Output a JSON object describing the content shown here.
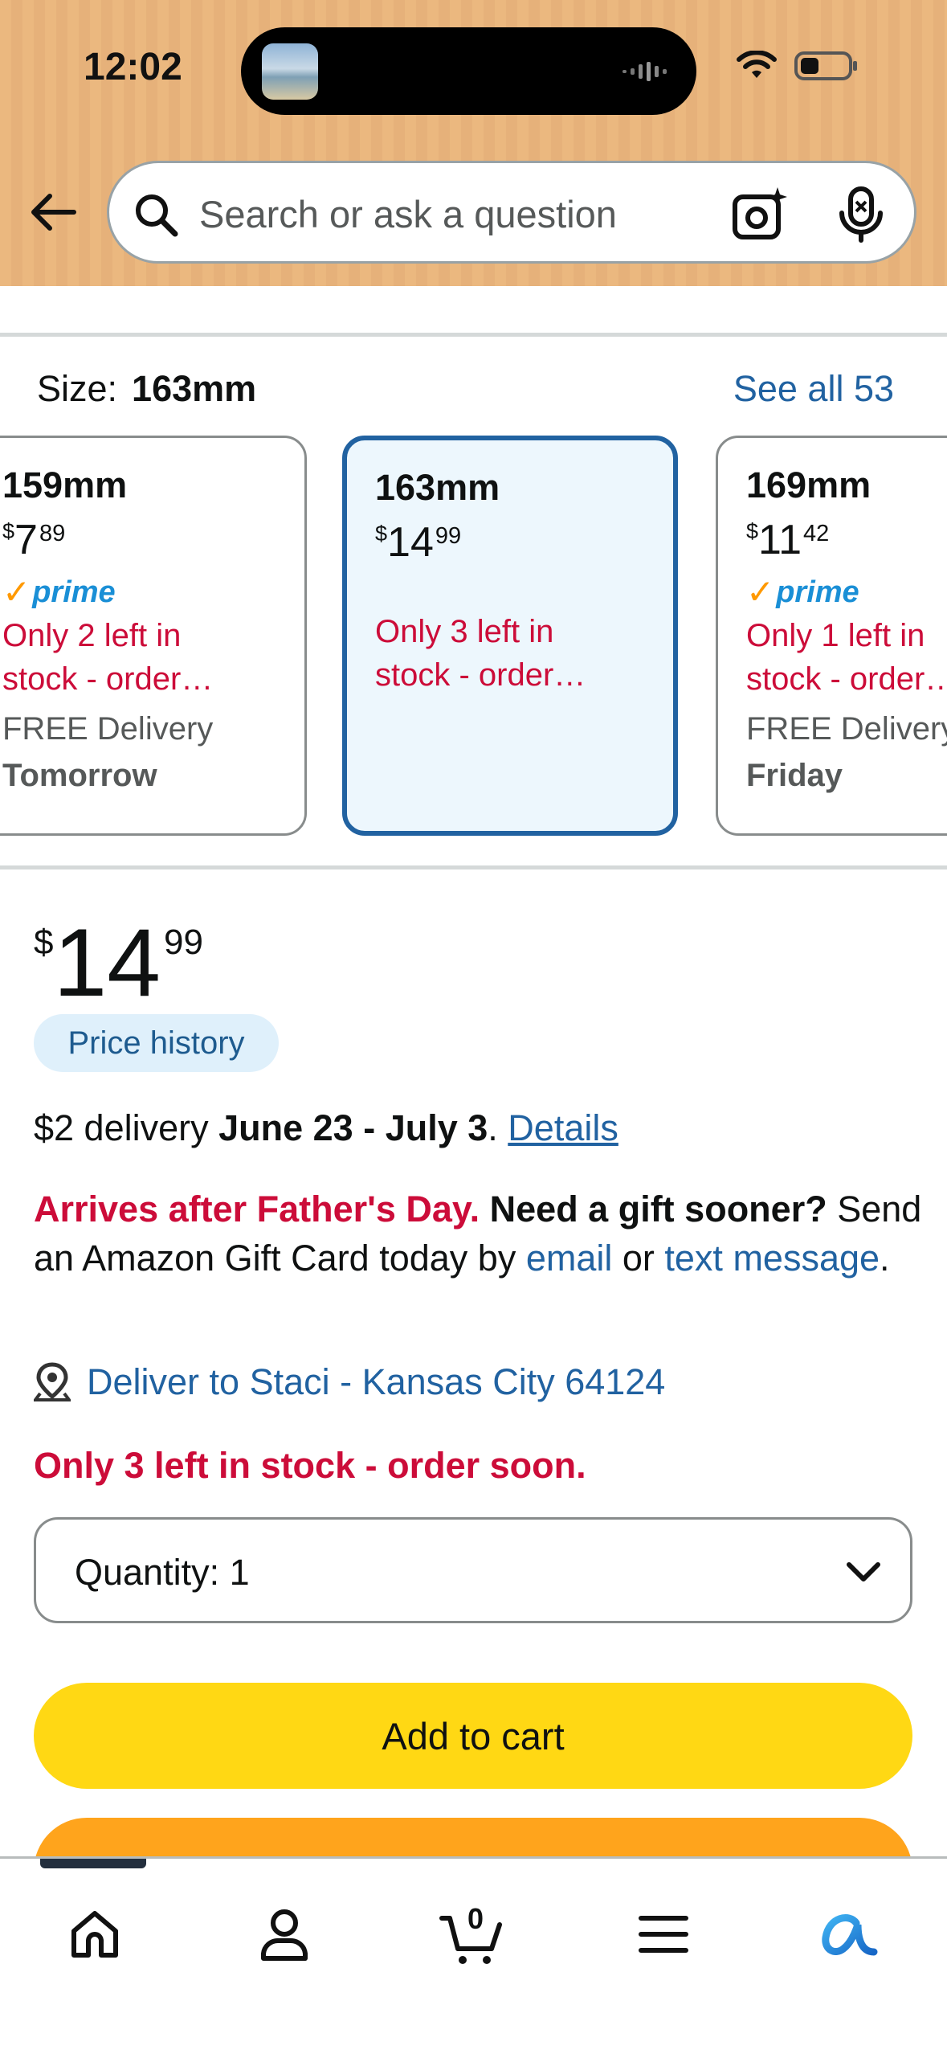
{
  "status_bar": {
    "time": "12:02"
  },
  "search": {
    "placeholder": "Search or ask a question"
  },
  "size_section": {
    "label": "Size:",
    "selected_value": "163mm",
    "see_all": "See all 53",
    "options": [
      {
        "title": "159mm",
        "price_currency": "$",
        "price_whole": "7",
        "price_cents": "89",
        "prime": "prime",
        "stock_line1": "Only 2 left in",
        "stock_line2": "stock - order…",
        "delivery": "FREE Delivery",
        "delivery_day": "Tomorrow",
        "selected": false
      },
      {
        "title": "163mm",
        "price_currency": "$",
        "price_whole": "14",
        "price_cents": "99",
        "stock_line1": "Only 3 left in",
        "stock_line2": "stock - order…",
        "selected": true
      },
      {
        "title": "169mm",
        "price_currency": "$",
        "price_whole": "11",
        "price_cents": "42",
        "prime": "prime",
        "stock_line1": "Only 1 left in",
        "stock_line2": "stock - order…",
        "delivery": "FREE Delivery",
        "delivery_day": "Friday",
        "selected": false
      }
    ]
  },
  "price": {
    "currency": "$",
    "whole": "14",
    "cents": "99"
  },
  "price_history": "Price history",
  "delivery": {
    "prefix": "$2 delivery ",
    "dates": "June 23 - July 3",
    "period": ". ",
    "details_link": "Details"
  },
  "gift": {
    "warning": "Arrives after Father's Day.",
    "question": "Need a gift sooner?",
    "text_before": "Send an Amazon Gift Card today by ",
    "email_link": "email",
    "or": " or ",
    "text_link": "text message",
    "end": "."
  },
  "deliver_to": "Deliver to Staci - Kansas City 64124",
  "stock_status": "Only 3 left in stock - order soon.",
  "quantity": {
    "label": "Quantity:",
    "value": "1"
  },
  "buttons": {
    "add_to_cart": "Add to cart"
  },
  "nav": {
    "cart_count": "0"
  },
  "colors": {
    "header_bg": "#ebb87f",
    "link": "#2162a1",
    "alert_red": "#cc0c39",
    "add_to_cart": "#ffd814",
    "buy_now": "#ffa41c",
    "selected_border": "#2162a1"
  }
}
